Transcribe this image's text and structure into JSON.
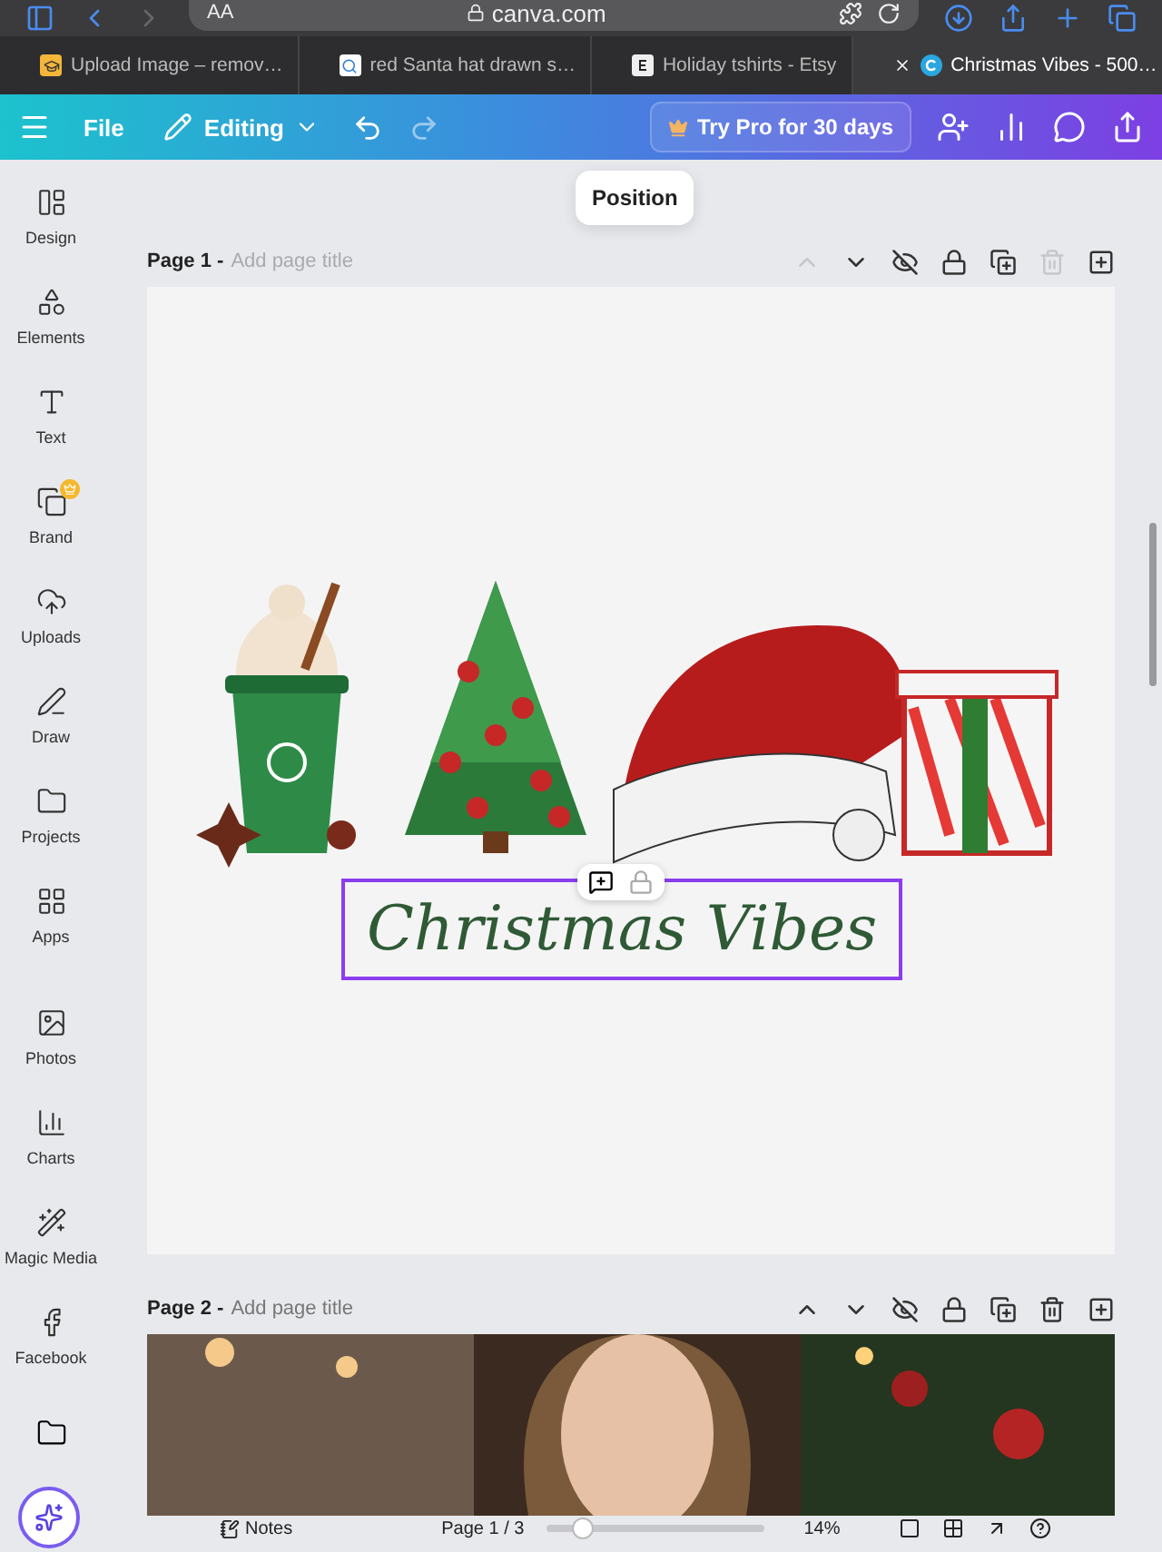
{
  "browser": {
    "text_size": "AA",
    "address": "canva.com",
    "tabs": [
      {
        "title": "Upload Image – remov…",
        "selected": false
      },
      {
        "title": "red Santa hat drawn s…",
        "selected": false
      },
      {
        "title": "Holiday tshirts - Etsy",
        "selected": false
      },
      {
        "title": "Christmas Vibes - 500…",
        "selected": true
      }
    ]
  },
  "toolbar": {
    "file": "File",
    "mode": "Editing",
    "promo": "Try Pro for 30 days"
  },
  "tooltip": "Position",
  "sidebar": {
    "items": [
      {
        "label": "Design",
        "premium": false
      },
      {
        "label": "Elements",
        "premium": false
      },
      {
        "label": "Text",
        "premium": false
      },
      {
        "label": "Brand",
        "premium": true
      },
      {
        "label": "Uploads",
        "premium": false
      },
      {
        "label": "Draw",
        "premium": false
      },
      {
        "label": "Projects",
        "premium": false
      },
      {
        "label": "Apps",
        "premium": false
      },
      {
        "label": "Photos",
        "premium": false
      },
      {
        "label": "Charts",
        "premium": false
      },
      {
        "label": "Magic Media",
        "premium": false
      },
      {
        "label": "Facebook",
        "premium": false
      }
    ]
  },
  "pages": [
    {
      "label": "Page 1 -",
      "title_placeholder": "Add page title",
      "kind": "design",
      "can_move_up": false,
      "can_delete": false,
      "heading": "Christmas Vibes",
      "heading_selected": true
    },
    {
      "label": "Page 2 -",
      "title_placeholder": "Add page title",
      "can_move_up": true,
      "can_delete": true
    }
  ],
  "footer": {
    "notes": "Notes",
    "page_indicator": "Page 1 / 3",
    "zoom": "14%",
    "zoom_slider": {
      "level": 0.12
    }
  }
}
